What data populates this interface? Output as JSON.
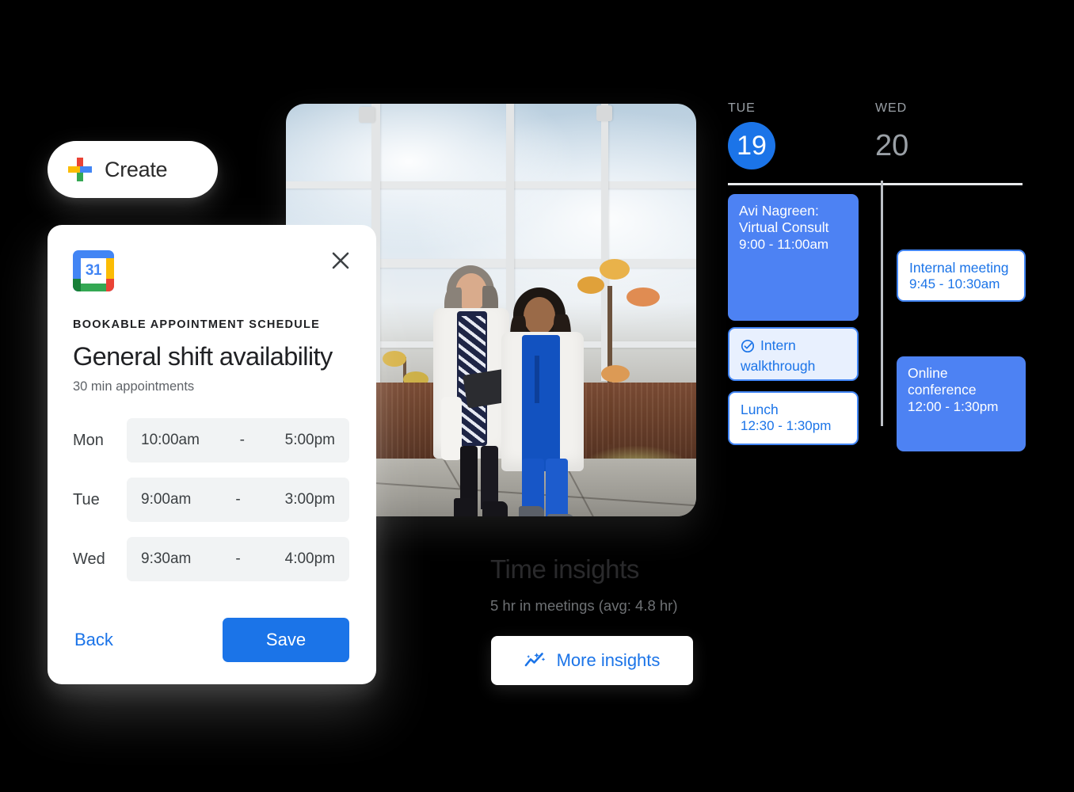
{
  "create_button": {
    "label": "Create",
    "icon": "google-plus-icon"
  },
  "photo": {
    "alt": "Two healthcare workers in white lab coats walking outdoors while looking at a tablet",
    "icon": "photo-card"
  },
  "dialog": {
    "app_icon": "google-calendar-icon",
    "app_icon_day": "31",
    "close_icon": "close-icon",
    "kicker": "BOOKABLE APPOINTMENT SCHEDULE",
    "title": "General shift availability",
    "subtitle": "30 min appointments",
    "slots": [
      {
        "day": "Mon",
        "start": "10:00am",
        "dash": "-",
        "end": "5:00pm"
      },
      {
        "day": "Tue",
        "start": "9:00am",
        "dash": "-",
        "end": "3:00pm"
      },
      {
        "day": "Wed",
        "start": "9:30am",
        "dash": "-",
        "end": "4:00pm"
      }
    ],
    "back_label": "Back",
    "save_label": "Save"
  },
  "calendar": {
    "columns": [
      {
        "dow": "TUE",
        "day": "19",
        "today": true
      },
      {
        "dow": "WED",
        "day": "20",
        "today": false
      }
    ],
    "events": [
      {
        "title": "Avi Nagreen:",
        "title2": "Virtual Consult",
        "time": "9:00 - 11:00am",
        "style": "filled",
        "icon": null
      },
      {
        "title": "Intern",
        "title2": "walkthrough",
        "time": "",
        "style": "tinted",
        "icon": "check-circle-icon"
      },
      {
        "title": "Lunch",
        "title2": "",
        "time": "12:30 - 1:30pm",
        "style": "outline",
        "icon": null
      },
      {
        "title": "Internal meeting",
        "title2": "",
        "time": "9:45 - 10:30am",
        "style": "outline",
        "icon": null
      },
      {
        "title": "Online",
        "title2": "conference",
        "time": "12:00 - 1:30pm",
        "style": "filled",
        "icon": null
      }
    ]
  },
  "insights": {
    "title": "Time insights",
    "subtitle": "5 hr in meetings (avg: 4.8 hr)",
    "button_label": "More insights",
    "button_icon": "insights-sparkle-icon"
  },
  "colors": {
    "brand_blue": "#1b74e8",
    "event_blue": "#4d82f3",
    "outline_blue": "#4285F4",
    "tinted_blue_bg": "#e8f0fe",
    "muted_gray": "#9aa0a6",
    "field_gray": "#f1f3f4",
    "background": "#000000"
  }
}
